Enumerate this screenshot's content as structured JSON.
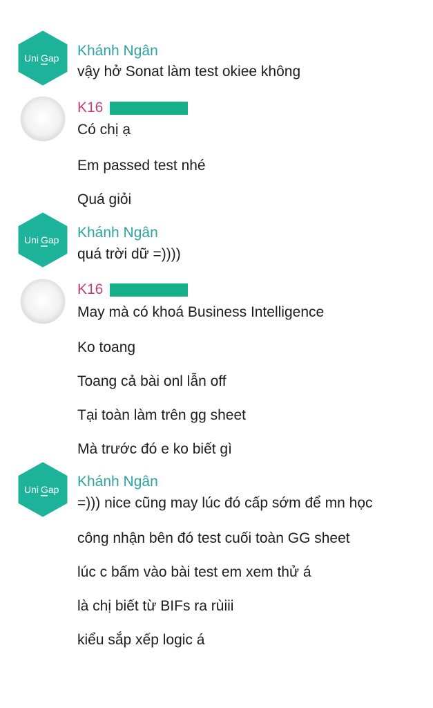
{
  "avatar_logo": {
    "text_left": "Uni",
    "text_right": "Gap",
    "bg": "#1cb39a"
  },
  "groups": [
    {
      "sender": "Khánh Ngân",
      "kind": "staff",
      "messages": [
        "vậy hở Sonat làm test okiee không"
      ]
    },
    {
      "sender": "K16",
      "kind": "student",
      "messages": [
        "Có chị ạ",
        "Em passed test nhé",
        "Quá giỏi"
      ]
    },
    {
      "sender": "Khánh Ngân",
      "kind": "staff",
      "messages": [
        "quá trời dữ =))))"
      ]
    },
    {
      "sender": "K16",
      "kind": "student",
      "messages": [
        "May mà có khoá Business Intelligence",
        "Ko toang",
        "Toang cả bài onl lẫn off",
        "Tại toàn làm trên gg sheet",
        "Mà trước đó e ko biết gì"
      ]
    },
    {
      "sender": "Khánh Ngân",
      "kind": "staff",
      "messages": [
        "=))) nice cũng may lúc đó cấp sớm để mn học",
        "công nhận bên đó test cuối toàn GG sheet",
        "lúc c bấm vào bài test em xem thử á",
        "là chị biết từ BIFs ra rùiii",
        "kiểu sắp xếp logic á"
      ]
    }
  ]
}
